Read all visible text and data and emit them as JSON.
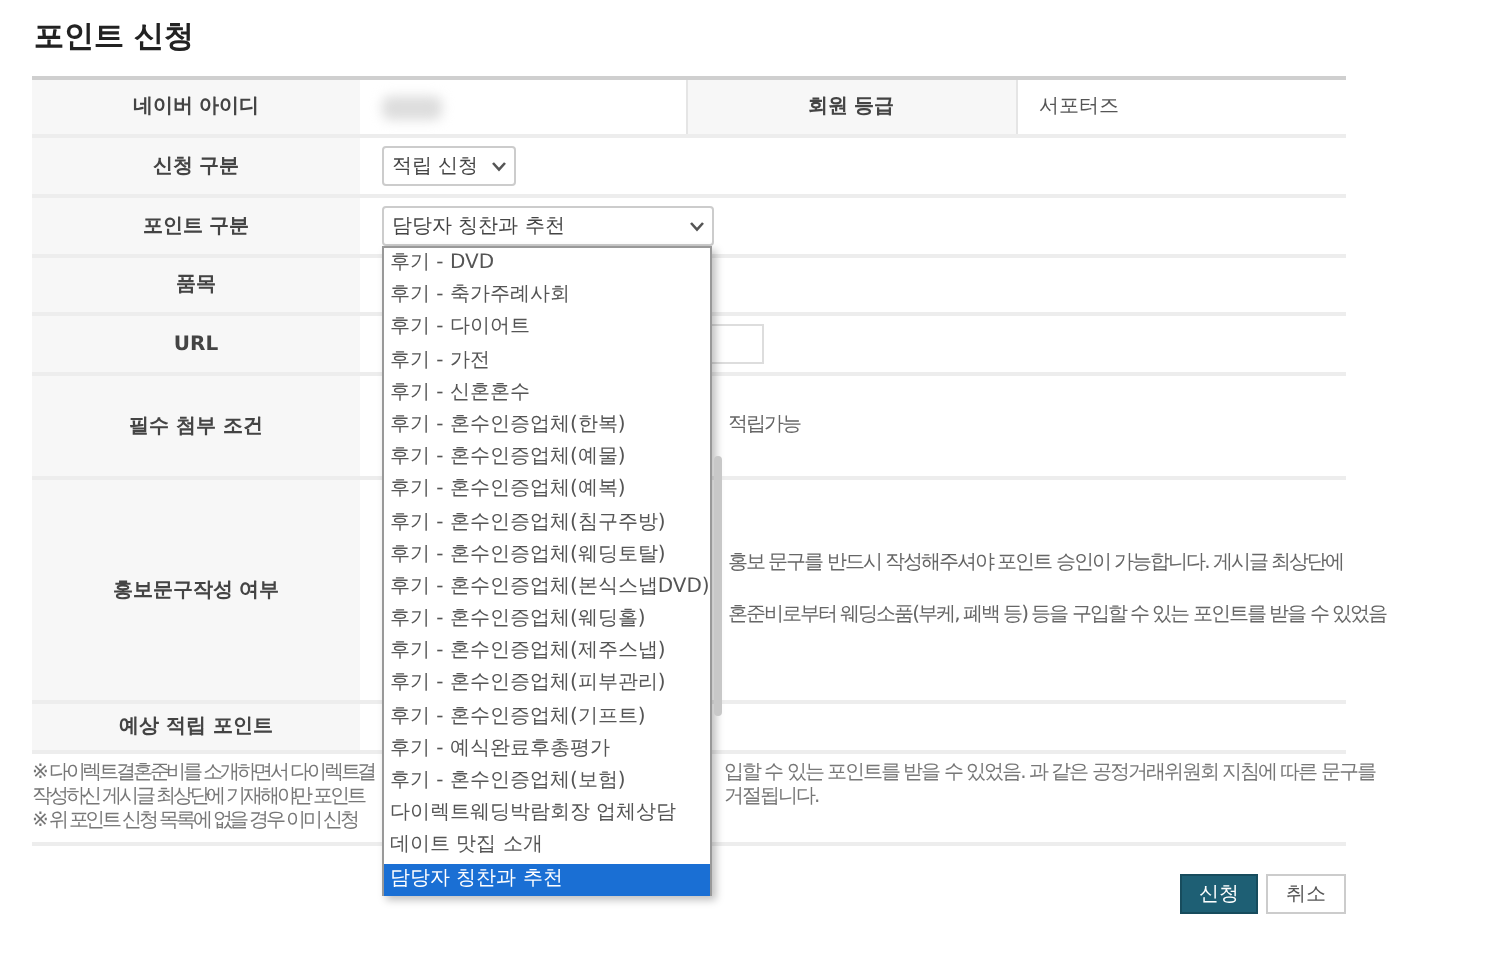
{
  "title": "포인트 신청",
  "member": {
    "id_label": "네이버 아이디",
    "grade_label": "회원 등급",
    "grade": "서포터즈"
  },
  "form_rows": [
    {
      "label": "신청 구분",
      "kind": "select",
      "value": "적립 신청"
    },
    {
      "label": "포인트 구분",
      "kind": "select",
      "value": "담당자 칭찬과 추천"
    },
    {
      "label": "품목",
      "kind": "blank"
    },
    {
      "label": "URL",
      "kind": "input"
    },
    {
      "label": "필수 첨부 조건",
      "kind": "text",
      "lines": [
        "적립가능"
      ]
    },
    {
      "label": "홍보문구작성 여부",
      "kind": "text",
      "lines": [
        "홍보 문구를 반드시 작성해주셔야 포인트 승인이 가능합니다. 게시글 최상단에",
        "혼준비로부터 웨딩소품(부케, 폐백 등) 등을 구입할 수 있는 포인트를 받을 수 있었음"
      ]
    },
    {
      "label": "예상 적립 포인트",
      "kind": "blank"
    }
  ],
  "dropdown": {
    "items": [
      {
        "label": "후기 - DVD",
        "selected": false
      },
      {
        "label": "후기 - 축가주례사회",
        "selected": false
      },
      {
        "label": "후기 - 다이어트",
        "selected": false
      },
      {
        "label": "후기 - 가전",
        "selected": false
      },
      {
        "label": "후기 - 신혼혼수",
        "selected": false
      },
      {
        "label": "후기 - 혼수인증업체(한복)",
        "selected": false
      },
      {
        "label": "후기 - 혼수인증업체(예물)",
        "selected": false
      },
      {
        "label": "후기 - 혼수인증업체(예복)",
        "selected": false
      },
      {
        "label": "후기 - 혼수인증업체(침구주방)",
        "selected": false
      },
      {
        "label": "후기 - 혼수인증업체(웨딩토탈)",
        "selected": false
      },
      {
        "label": "후기 - 혼수인증업체(본식스냅DVD)",
        "selected": false
      },
      {
        "label": "후기 - 혼수인증업체(웨딩홀)",
        "selected": false
      },
      {
        "label": "후기 - 혼수인증업체(제주스냅)",
        "selected": false
      },
      {
        "label": "후기 - 혼수인증업체(피부관리)",
        "selected": false
      },
      {
        "label": "후기 - 혼수인증업체(기프트)",
        "selected": false
      },
      {
        "label": "후기 - 예식완료후총평가",
        "selected": false
      },
      {
        "label": "후기 - 혼수인증업체(보험)",
        "selected": false
      },
      {
        "label": "다이렉트웨딩박람회장 업체상담",
        "selected": false
      },
      {
        "label": "데이트 맛집 소개",
        "selected": false
      },
      {
        "label": "담당자 칭찬과 추천",
        "selected": true
      }
    ]
  },
  "notes": [
    {
      "left": "※ 다이렉트결혼준비를 소개하면서 다이렉트결",
      "right": "입할 수 있는 포인트를 받을 수 있었음. 과 같은 공정거래위원회 지침에 따른 문구를"
    },
    {
      "left": "작성하신 게시글 최상단에 기재해야만 포인트",
      "right": "거절됩니다."
    },
    {
      "left": "※ 위 포인트 신청 목록에 없을 경우 이미 신청"
    }
  ],
  "buttons": [
    {
      "label": "신청",
      "kind": "primary"
    },
    {
      "label": "취소",
      "kind": "secondary"
    }
  ]
}
